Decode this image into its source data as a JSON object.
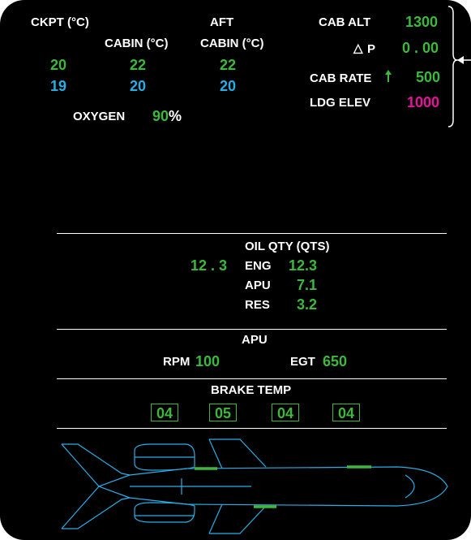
{
  "cabin": {
    "ckpt_label": "CKPT (°C)",
    "aft_label": "AFT",
    "cabin_label": "CABIN (°C)",
    "aft_cabin_label": "CABIN (°C)",
    "ckpt_actual": "20",
    "cabin_actual": "22",
    "aft_actual": "22",
    "ckpt_target": "19",
    "cabin_target": "20",
    "aft_target": "20"
  },
  "oxygen": {
    "label": "OXYGEN",
    "value": "90",
    "unit": "%"
  },
  "pressure": {
    "cab_alt_label": "CAB ALT",
    "cab_alt_value": "1300",
    "dp_symbol": "△",
    "dp_label": "P",
    "dp_value": "0 . 00",
    "cab_rate_label": "CAB RATE",
    "cab_rate_value": "500",
    "ldg_elev_label": "LDG ELEV",
    "ldg_elev_value": "1000"
  },
  "oil": {
    "title": "OIL QTY (QTS)",
    "total": "12 . 3",
    "eng_label": "ENG",
    "eng_value": "12.3",
    "apu_label": "APU",
    "apu_value": "7.1",
    "res_label": "RES",
    "res_value": "3.2"
  },
  "apu": {
    "title": "APU",
    "rpm_label": "RPM",
    "rpm_value": "100",
    "egt_label": "EGT",
    "egt_value": "650"
  },
  "brakes": {
    "title": "BRAKE TEMP",
    "values": [
      "04",
      "05",
      "04",
      "04"
    ]
  },
  "colors": {
    "green": "#3cb83c",
    "cyan": "#28aee6",
    "magenta": "#e6129a",
    "white": "#ffffff",
    "background": "#000000"
  }
}
